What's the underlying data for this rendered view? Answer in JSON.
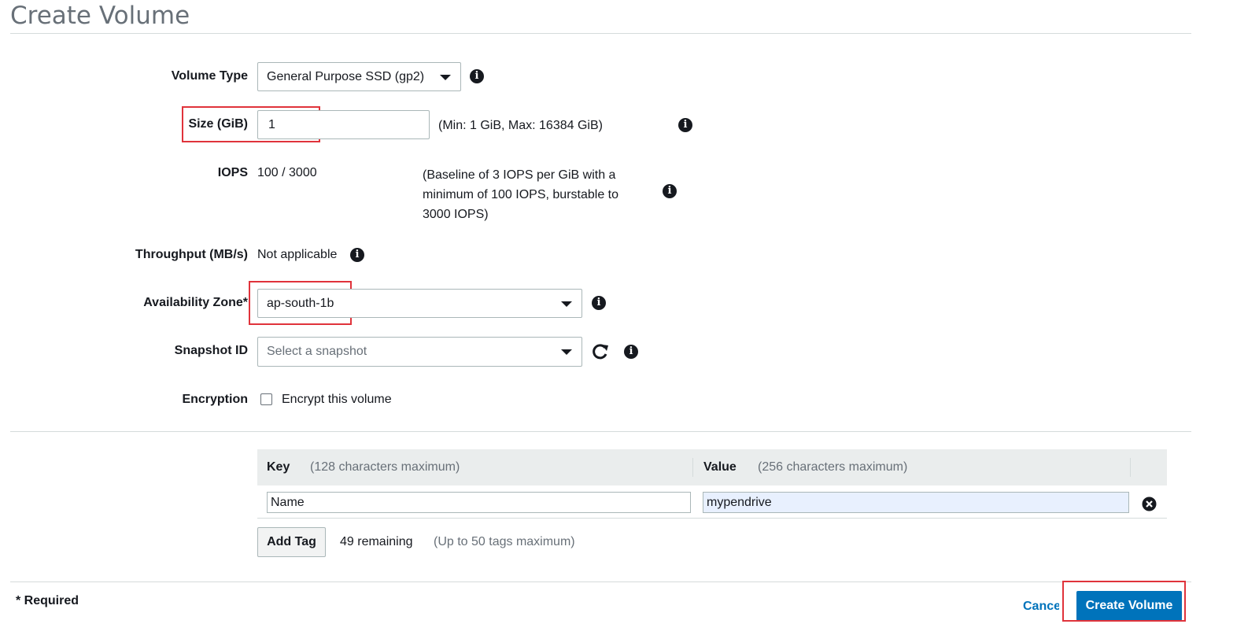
{
  "page": {
    "title": "Create Volume"
  },
  "form": {
    "volume_type": {
      "label": "Volume Type",
      "value": "General Purpose SSD (gp2)"
    },
    "size": {
      "label": "Size (GiB)",
      "value": "1",
      "hint": "(Min: 1 GiB, Max: 16384 GiB)"
    },
    "iops": {
      "label": "IOPS",
      "value": "100 / 3000",
      "hint_lines": [
        "(Baseline of 3 IOPS per GiB with a",
        "minimum of 100 IOPS, burstable to",
        "3000 IOPS)"
      ]
    },
    "throughput": {
      "label": "Throughput (MB/s)",
      "value": "Not applicable"
    },
    "availability_zone": {
      "label": "Availability Zone*",
      "value": "ap-south-1b"
    },
    "snapshot": {
      "label": "Snapshot ID",
      "placeholder": "Select a snapshot"
    },
    "encryption": {
      "label": "Encryption",
      "checkbox_label": "Encrypt this volume",
      "checked": false
    }
  },
  "tags": {
    "key_header": "Key",
    "key_hint": "(128 characters maximum)",
    "value_header": "Value",
    "value_hint": "(256 characters maximum)",
    "rows": [
      {
        "key": "Name",
        "value": "mypendrive"
      }
    ],
    "add_label": "Add Tag",
    "remaining": "49 remaining",
    "limit_hint": "(Up to 50 tags maximum)"
  },
  "footer": {
    "required_note": "* Required",
    "cancel_label": "Cancel",
    "create_label": "Create Volume"
  },
  "icons": {
    "info": "info-icon",
    "refresh": "refresh-icon",
    "remove": "remove-tag-icon",
    "dropdown": "chevron-down-icon"
  },
  "colors": {
    "accent": "#0073bb",
    "highlight": "#e0333b",
    "muted": "#687078"
  }
}
